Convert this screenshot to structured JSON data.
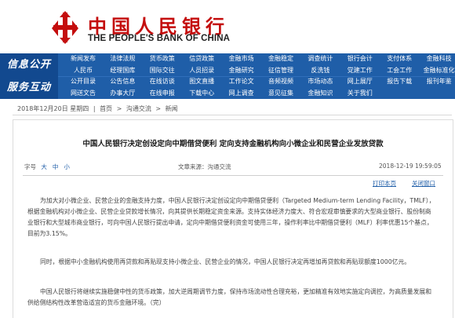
{
  "header": {
    "logo_cn": "中国人民银行",
    "logo_en": "THE PEOPLE'S BANK OF CHINA"
  },
  "nav": {
    "row1_label": "信息公开",
    "row2_label": "服务互动",
    "row1": [
      [
        "新闻发布",
        "法律法规",
        "货币政策",
        "信贷政策",
        "金融市场",
        "金融稳定",
        "调查统计",
        "银行会计",
        "支付体系",
        "金融科技"
      ],
      [
        "人民币",
        "经理国库",
        "国际交往",
        "人员招录",
        "金融研究",
        "征信管理",
        "反洗钱",
        "党建工作",
        "工会工作",
        "金融标准化"
      ]
    ],
    "row2": [
      [
        "公开目录",
        "公告信息",
        "在线访谈",
        "图文直播",
        "工作论文",
        "音频视频",
        "市场动态",
        "网上展厅",
        "报告下载",
        "报刊年鉴"
      ],
      [
        "网送文告",
        "办事大厅",
        "在线申报",
        "下载中心",
        "网上调查",
        "意见征集",
        "金融知识",
        "关于我们",
        "",
        ""
      ]
    ]
  },
  "breadcrumb": {
    "date": "2018年12月20日 星期四",
    "sep": "|",
    "path": [
      "首页",
      "沟通交流",
      "新闻"
    ]
  },
  "article": {
    "title": "中国人民银行决定创设定向中期借贷便利 定向支持金融机构向小微企业和民营企业发放贷款",
    "font_label": "字号",
    "font_sizes": [
      "大",
      "中",
      "小"
    ],
    "source": "文章来源：沟通交流",
    "datetime": "2018-12-19  19:59:05",
    "print": "打印本页",
    "close": "关闭窗口",
    "paragraphs": [
      "为加大对小微企业、民营企业的金融支持力度，中国人民银行决定创设定向中期借贷便利（Targeted Medium-term Lending Facility，TMLF），根据金融机构对小微企业、民营企业贷款增长情况，向其提供长期稳定资金来源。支持实体经济力度大、符合宏观审慎要求的大型商业银行、股份制商业银行和大型城市商业银行，可向中国人民银行提出申请，定向中期借贷便利资金可使用三年，操作利率比中期借贷便利（MLF）利率优惠15个基点，目前为3.15%。",
      "同时，根据中小金融机构使用再贷款和再贴现支持小微企业、民营企业的情况，中国人民银行决定再增加再贷款和再贴现额度1000亿元。",
      "中国人民银行将继续实施稳健中性的货币政策，加大逆周期调节力度，保持市场流动性合理充裕，更加精准有效地实施定向调控，为高质量发展和供给侧结构性改革营造适宜的货币金融环境。（完）"
    ]
  },
  "colors": {
    "brand_red": "#c40d0d",
    "nav_blue": "#1f5ea8",
    "nav_dark": "#12498f"
  }
}
